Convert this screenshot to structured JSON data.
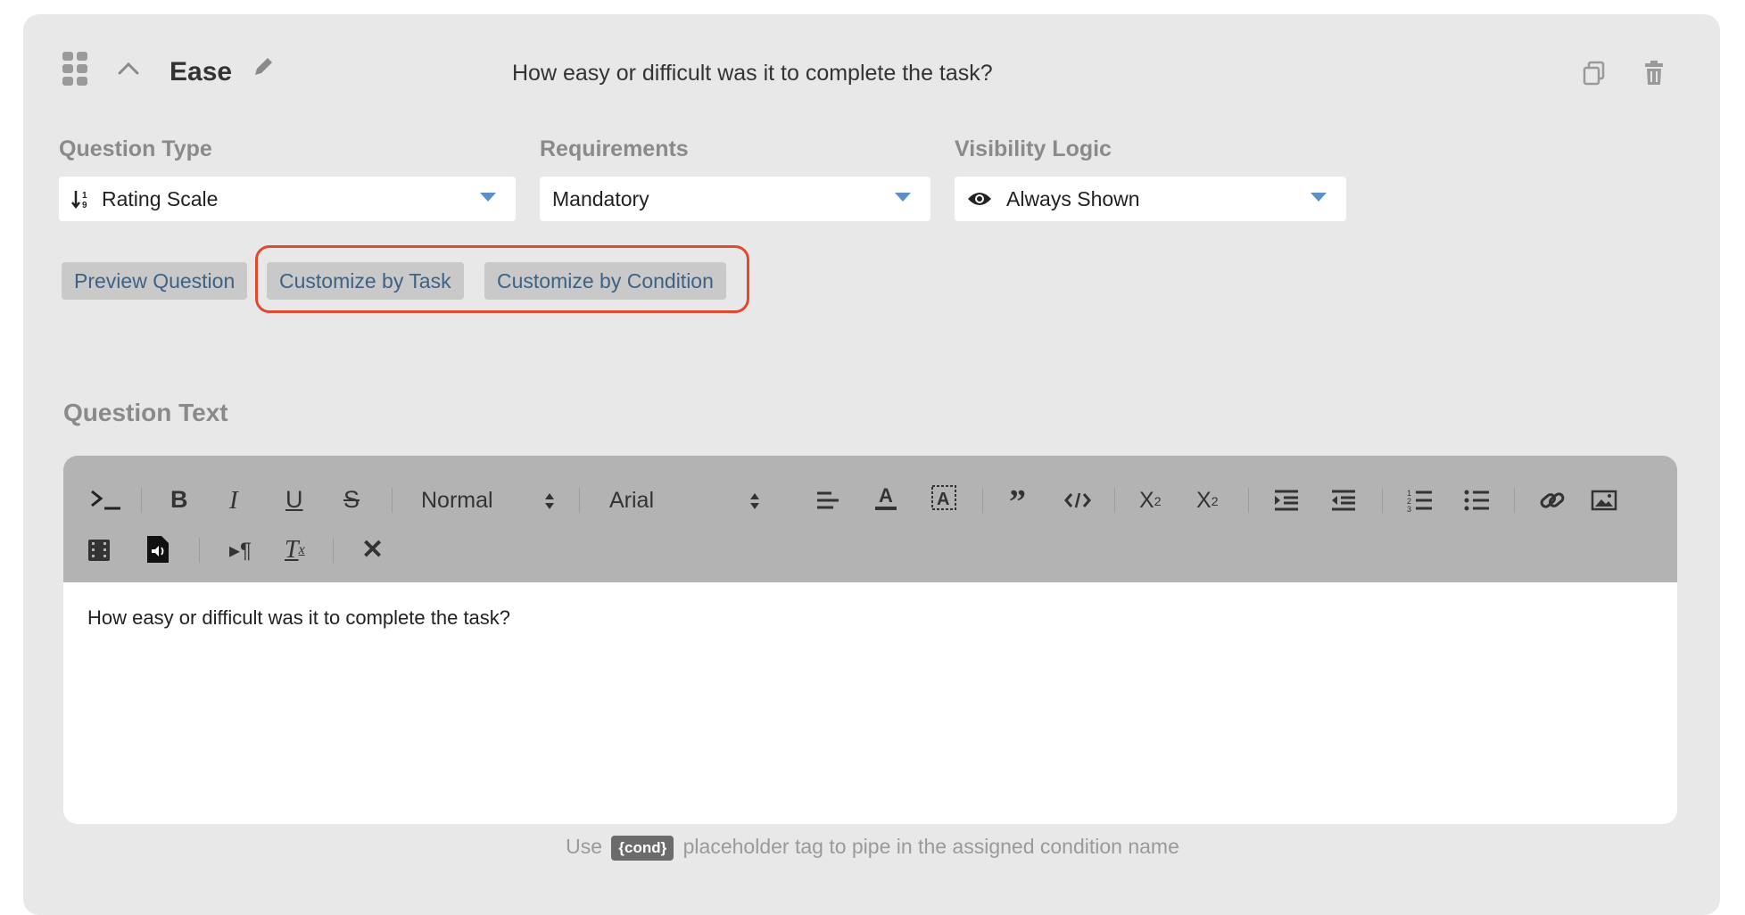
{
  "question": {
    "title": "Ease",
    "text_preview": "How easy or difficult was it to complete the task?"
  },
  "fields": {
    "type_label": "Question Type",
    "type_value": "Rating Scale",
    "req_label": "Requirements",
    "req_value": "Mandatory",
    "vis_label": "Visibility Logic",
    "vis_value": "Always Shown"
  },
  "buttons": {
    "preview": "Preview Question",
    "by_task": "Customize by Task",
    "by_condition": "Customize by Condition"
  },
  "editor": {
    "section_label": "Question Text",
    "format_value": "Normal",
    "font_value": "Arial",
    "body_text": "How easy or difficult was it to complete the task?"
  },
  "hint": {
    "prefix": "Use",
    "tag": "{cond}",
    "suffix": "placeholder tag to pipe in the assigned condition name"
  },
  "colors": {
    "highlight": "#e24a30",
    "caret": "#5b8fc9",
    "button_text": "#3d6285"
  },
  "icons": [
    "drag-handle-icon",
    "chevron-up-icon",
    "pencil-icon",
    "copy-icon",
    "trash-icon",
    "sort-icon",
    "eye-icon",
    "terminal-icon",
    "bold-icon",
    "italic-icon",
    "underline-icon",
    "strikethrough-icon",
    "align-left-icon",
    "font-color-icon",
    "highlight-color-icon",
    "blockquote-icon",
    "code-icon",
    "subscript-icon",
    "superscript-icon",
    "indent-icon",
    "outdent-icon",
    "ordered-list-icon",
    "bullet-list-icon",
    "link-icon",
    "image-icon",
    "video-icon",
    "audio-icon",
    "text-direction-icon",
    "clear-format-icon",
    "close-icon"
  ]
}
